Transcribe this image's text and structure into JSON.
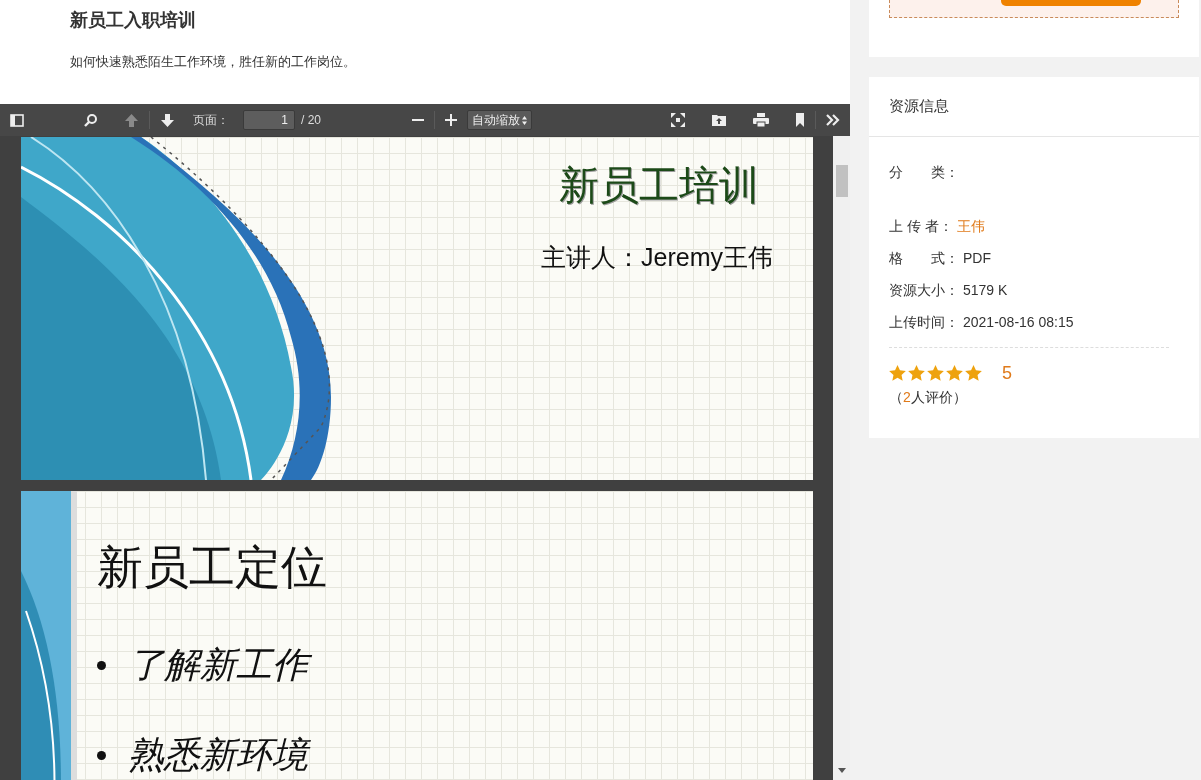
{
  "document": {
    "title": "新员工入职培训",
    "description": "如何快速熟悉陌生工作环境，胜任新的工作岗位。"
  },
  "pdf_viewer": {
    "previous_page": {
      "disabled": true
    },
    "next_page": {
      "disabled": false
    },
    "page_label": "页面：",
    "page_value": "1",
    "page_total": "/ 20",
    "zoom": "自动缩放",
    "pages": [
      {
        "kind": "title",
        "title": "新员工培训",
        "subtitle": "主讲人：Jeremy王伟"
      },
      {
        "kind": "outline",
        "title": "新员工定位",
        "bullets": [
          "了解新工作",
          "熟悉新环境"
        ]
      }
    ]
  },
  "resource_info": {
    "heading": "资源信息",
    "fields": [
      {
        "label": "分　　类："
      },
      {
        "label": "上 传 者：",
        "value": "王伟",
        "link": true
      },
      {
        "label": "格　　式：",
        "value": "PDF",
        "link": false
      },
      {
        "label": "资源大小：",
        "value": "5179 K",
        "link": false
      },
      {
        "label": "上传时间：",
        "value": "2021-08-16 08:15",
        "link": false
      }
    ],
    "rating": {
      "stars": 5,
      "score": "5",
      "review_before": "（",
      "review_count": "2",
      "review_after": "人评价）"
    }
  }
}
